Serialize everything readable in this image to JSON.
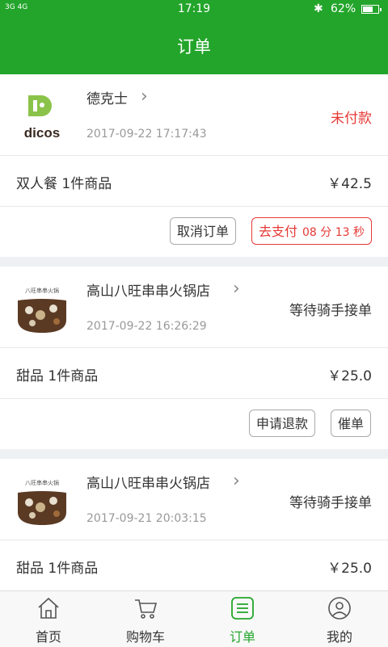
{
  "status_bar": {
    "signal": "3G 4G",
    "time": "17:19",
    "bluetooth": "✱",
    "battery": "62%"
  },
  "header": {
    "title": "订单"
  },
  "orders": [
    {
      "shop": "德克士",
      "logo_text": "dicos",
      "date": "2017-09-22 17:17:43",
      "status": "未付款",
      "status_color": "#e53935",
      "item": "双人餐 1件商品",
      "price": "￥42.5",
      "cancel_label": "取消订单",
      "pay_label": "去支付",
      "countdown": "08 分 13 秒"
    },
    {
      "shop": "高山八旺串串火锅店",
      "date": "2017-09-22 16:26:29",
      "status": "等待骑手接单",
      "status_color": "#333333",
      "item": "甜品 1件商品",
      "price": "￥25.0",
      "refund_label": "申请退款",
      "urge_label": "催单"
    },
    {
      "shop": "高山八旺串串火锅店",
      "date": "2017-09-21 20:03:15",
      "status": "等待骑手接单",
      "status_color": "#333333",
      "item": "甜品 1件商品",
      "price": "￥25.0"
    }
  ],
  "tabs": [
    {
      "label": "首页",
      "icon": "home-icon"
    },
    {
      "label": "购物车",
      "icon": "cart-icon"
    },
    {
      "label": "订单",
      "icon": "orders-icon",
      "active": true
    },
    {
      "label": "我的",
      "icon": "profile-icon"
    }
  ],
  "colors": {
    "brand": "#23a52b",
    "alert": "#e53935"
  }
}
